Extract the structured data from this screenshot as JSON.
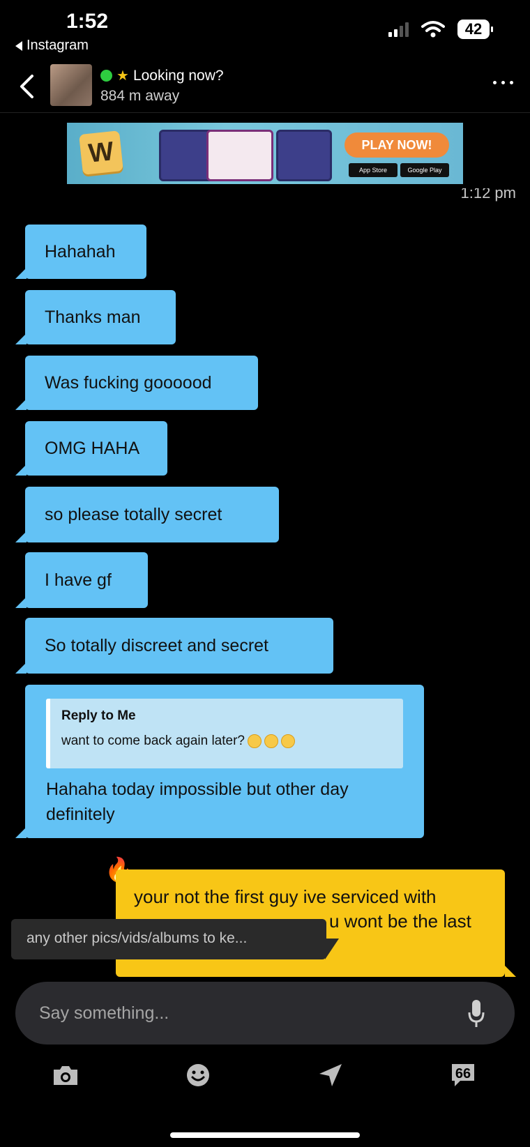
{
  "status_bar": {
    "time": "1:52",
    "back_app": "Instagram",
    "battery": "42"
  },
  "header": {
    "title": "Looking now?",
    "distance": "884 m away",
    "online_color": "#2ecc40",
    "star_color": "#f5c518"
  },
  "ad": {
    "logo_letter": "W",
    "cta": "PLAY NOW!",
    "store_1": "App Store",
    "store_2": "Google Play"
  },
  "timestamp": "1:12 pm",
  "messages_in": [
    {
      "text": "Hahahah"
    },
    {
      "text": "Thanks man"
    },
    {
      "text": "Was fucking goooood"
    },
    {
      "text": "OMG HAHA"
    },
    {
      "text": "so please totally secret"
    },
    {
      "text": "I have gf"
    },
    {
      "text": "So totally discreet and secret"
    }
  ],
  "reply_message": {
    "reply_title": "Reply to Me",
    "quoted_text": "want to come back again later?",
    "text_line_1": "Hahaha today impossible but other day",
    "text_line_2": "definitely"
  },
  "message_out": {
    "line_1": "your not the first guy ive serviced with",
    "line_2": "u wont be the last"
  },
  "suggestion": "any other pics/vids/albums to ke...",
  "composer": {
    "placeholder": "Say something..."
  },
  "colors": {
    "incoming_bubble": "#63c2f5",
    "outgoing_bubble": "#f8c616",
    "background": "#000000"
  },
  "bottom_bar": {
    "icons": [
      "camera-icon",
      "emoji-icon",
      "location-icon",
      "saved-phrases-icon"
    ]
  }
}
